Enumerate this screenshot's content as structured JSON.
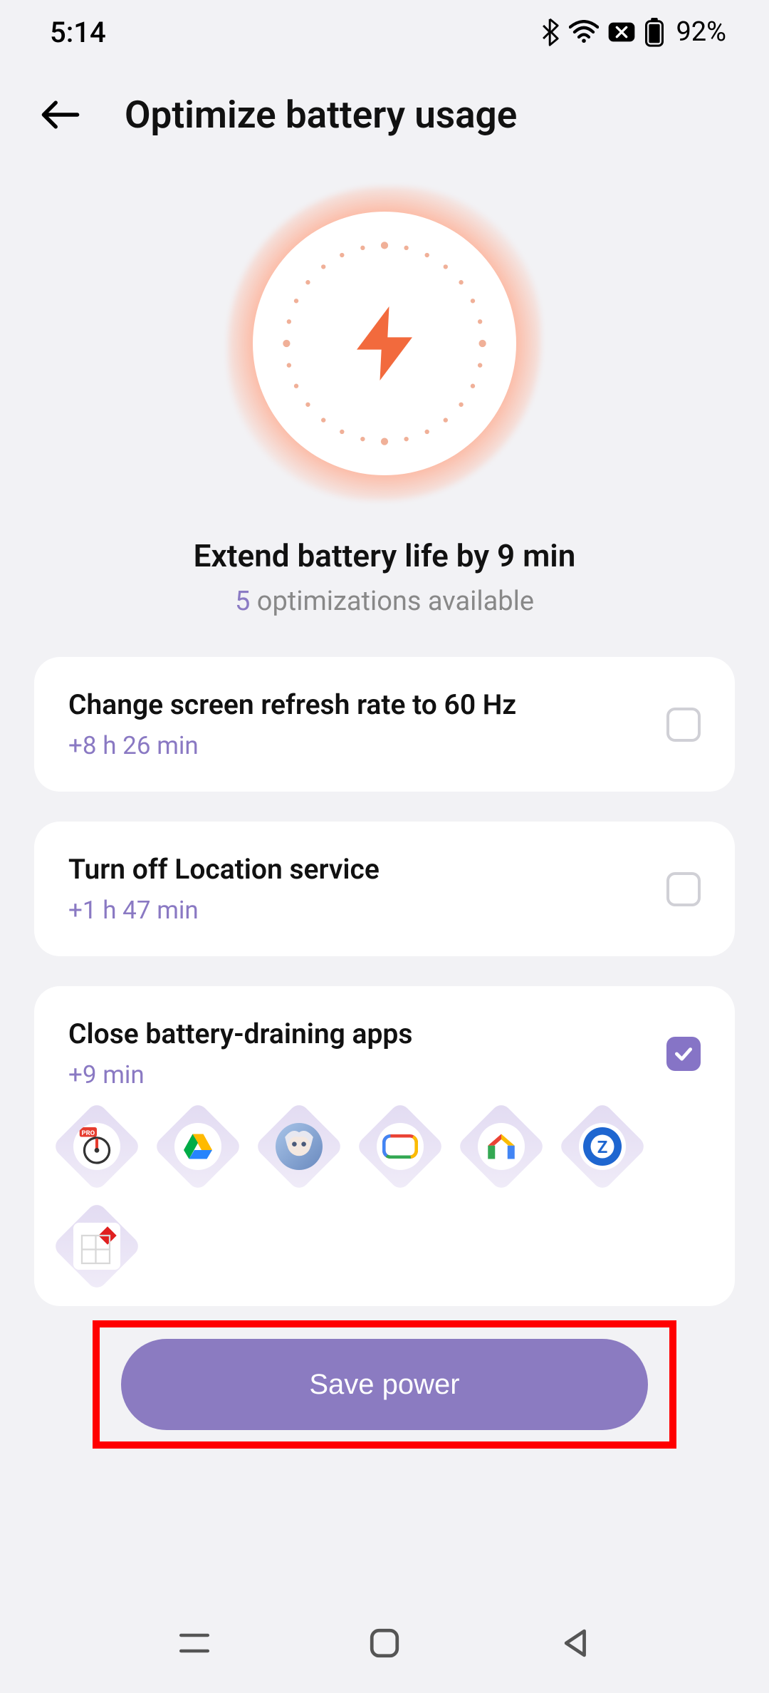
{
  "status": {
    "time": "5:14",
    "battery": "92%"
  },
  "header": {
    "title": "Optimize battery usage"
  },
  "hero": {
    "title": "Extend battery life by 9 min",
    "sub_count": "5",
    "sub_rest": " optimizations available"
  },
  "optimizations": [
    {
      "title": "Change screen refresh rate to 60 Hz",
      "gain": "+8 h 26 min",
      "checked": false
    },
    {
      "title": "Turn off Location service",
      "gain": "+1 h 47 min",
      "checked": false
    },
    {
      "title": "Close battery-draining apps",
      "gain": "+9 min",
      "checked": true
    }
  ],
  "draining_apps": [
    "speedometer-pro",
    "google-drive",
    "anime-game",
    "google-tv",
    "google-home",
    "z-app",
    "health-app"
  ],
  "cta": {
    "label": "Save power"
  }
}
